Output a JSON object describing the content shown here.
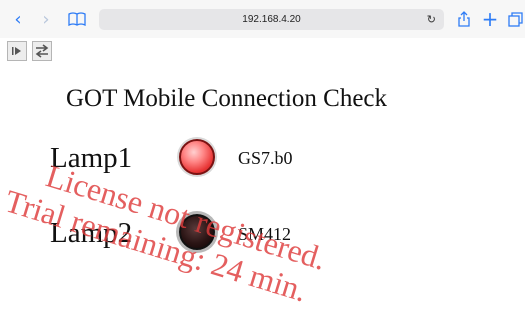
{
  "browser": {
    "url": "192.168.4.20",
    "reload_glyph": "C"
  },
  "page": {
    "title": "GOT Mobile Connection Check",
    "lamps": [
      {
        "label": "Lamp1",
        "device": "GS7.b0",
        "state": "on",
        "color": "#e83636"
      },
      {
        "label": "Lamp2",
        "device": "SM412",
        "state": "off",
        "color": "#1a0707"
      }
    ]
  },
  "watermark": {
    "line1": "License not registered.",
    "line2": "Trial remaining: 24 min."
  }
}
